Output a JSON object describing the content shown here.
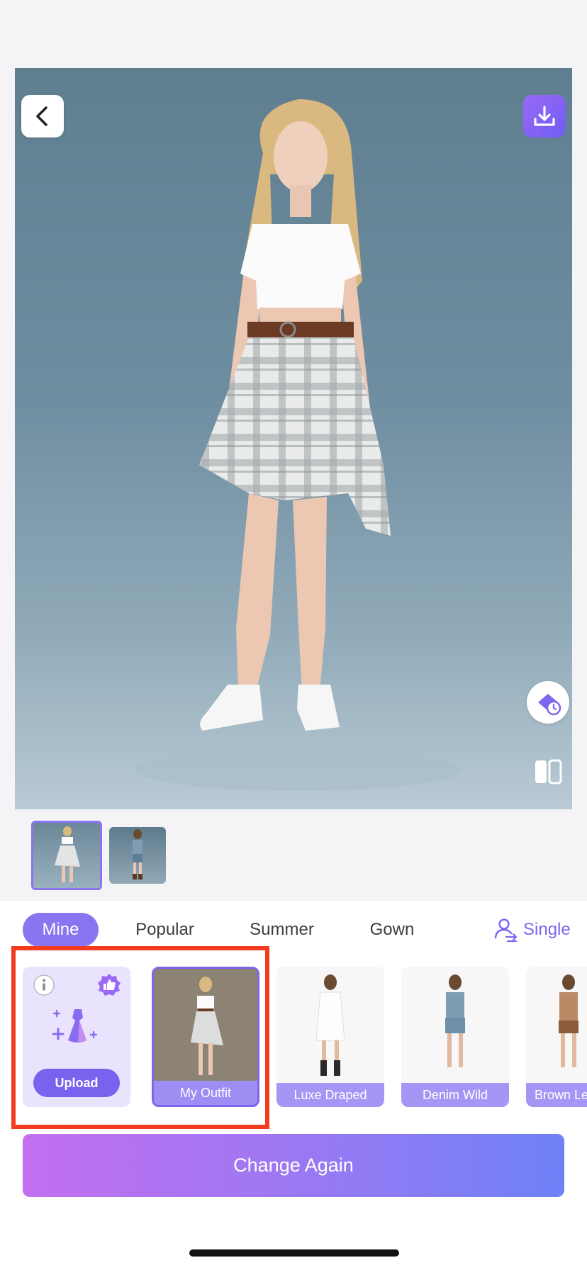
{
  "tabs": [
    "Mine",
    "Popular",
    "Summer",
    "Gown"
  ],
  "mode_label": "Single",
  "upload_label": "Upload",
  "outfits": [
    {
      "label": "My Outfit",
      "selected": true
    },
    {
      "label": "Luxe Draped",
      "selected": false
    },
    {
      "label": "Denim Wild",
      "selected": false
    },
    {
      "label": "Brown Le",
      "selected": false
    }
  ],
  "primary_action": "Change Again",
  "colors": {
    "accent": "#8b74f0",
    "highlight": "#f23b1f",
    "gradient_start": "#c36ff0",
    "gradient_end": "#6e81f6"
  },
  "icons": {
    "back": "chevron-left-icon",
    "download": "download-icon",
    "history": "history-icon",
    "compare": "compare-icon",
    "info": "info-icon",
    "badge": "thumbs-up-badge-icon",
    "dress": "dress-sparkle-icon",
    "single": "person-swap-icon"
  }
}
